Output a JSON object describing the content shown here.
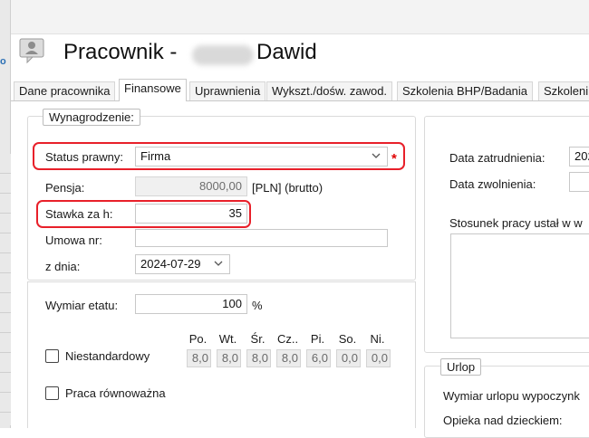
{
  "header": {
    "title_prefix": "Pracownik -",
    "title_name": "Dawid"
  },
  "tabs": [
    {
      "label": "Dane pracownika"
    },
    {
      "label": "Finansowe"
    },
    {
      "label": "Uprawnienia"
    },
    {
      "label": "Wykszt./dośw. zawod."
    },
    {
      "label": "Szkolenia BHP/Badania"
    },
    {
      "label": "Szkoleni"
    }
  ],
  "wynagrodzenie": {
    "legend": "Wynagrodzenie:",
    "status_label": "Status prawny:",
    "status_value": "Firma",
    "required_mark": "*",
    "pensja_label": "Pensja:",
    "pensja_value": "8000,00",
    "pensja_suffix": "[PLN] (brutto)",
    "stawka_label": "Stawka za h:",
    "stawka_value": "35",
    "umowa_label": "Umowa nr:",
    "umowa_value": "",
    "z_dnia_label": "z dnia:",
    "z_dnia_value": "2024-07-29"
  },
  "etat": {
    "wymiar_label": "Wymiar etatu:",
    "wymiar_value": "100",
    "wymiar_suffix": "%",
    "niestandardowy_label": "Niestandardowy",
    "praca_label": "Praca równoważna",
    "days": [
      {
        "label": "Po.",
        "value": "8,0"
      },
      {
        "label": "Wt.",
        "value": "8,0"
      },
      {
        "label": "Śr.",
        "value": "8,0"
      },
      {
        "label": "Cz..",
        "value": "8,0"
      },
      {
        "label": "Pi.",
        "value": "6,0"
      },
      {
        "label": "So.",
        "value": "0,0"
      },
      {
        "label": "Ni.",
        "value": "0,0"
      }
    ]
  },
  "right": {
    "zatrudnienia_label": "Data zatrudnienia:",
    "zatrudnienia_value": "202",
    "zwolnienia_label": "Data zwolnienia:",
    "stosunek_label": "Stosunek pracy ustał w w",
    "urlop_legend": "Urlop",
    "wymiar_urlopu_label": "Wymiar urlopu wypoczynk",
    "opieka_label": "Opieka nad dzieckiem:"
  }
}
